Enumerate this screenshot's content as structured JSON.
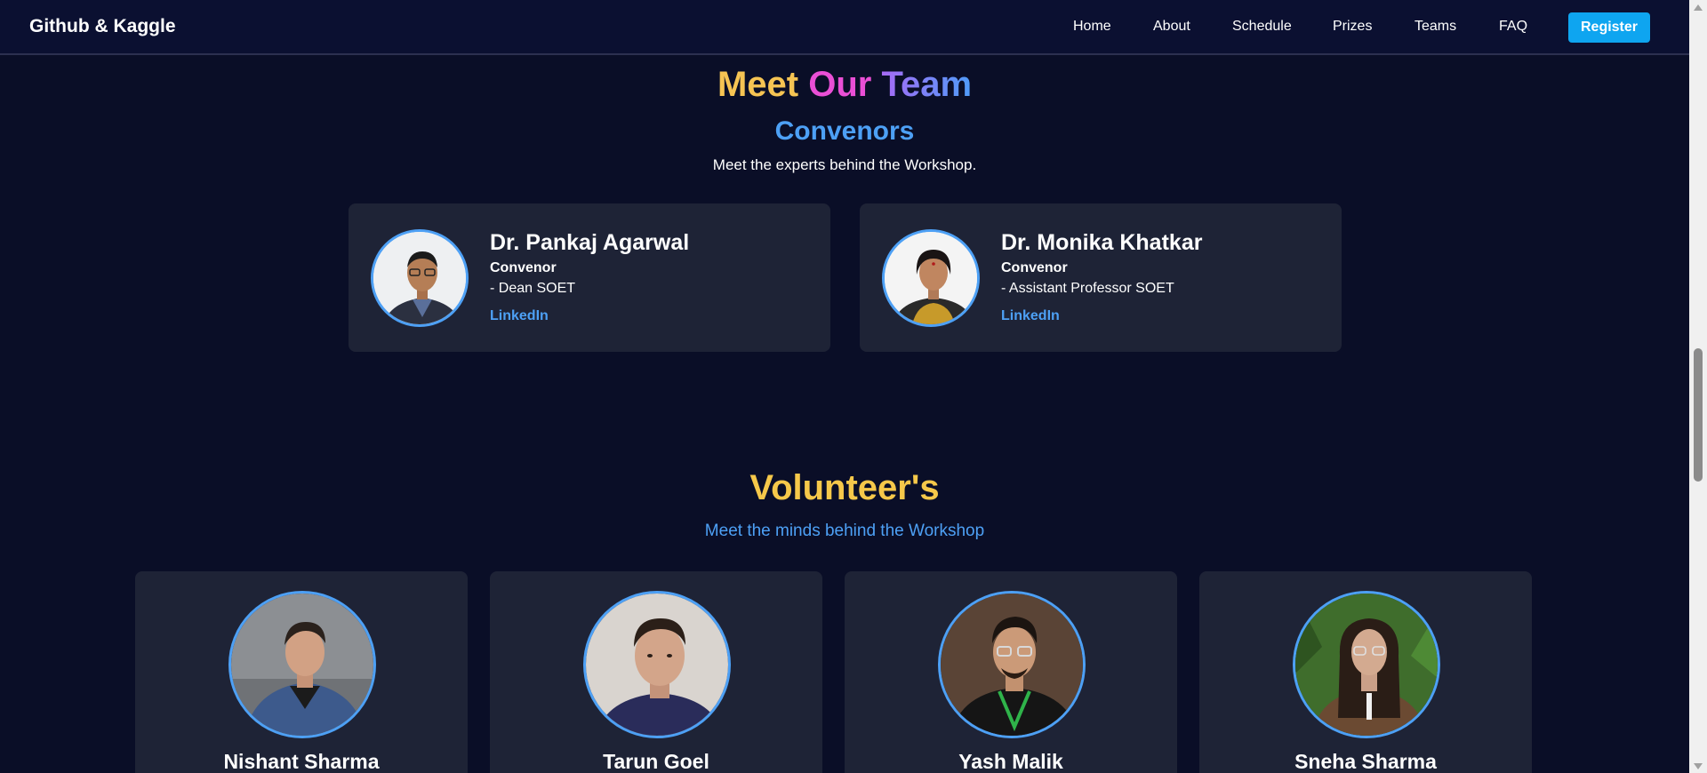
{
  "navbar": {
    "brand": "Github & Kaggle",
    "links": [
      "Home",
      "About",
      "Schedule",
      "Prizes",
      "Teams",
      "FAQ"
    ],
    "register_label": "Register"
  },
  "team_section": {
    "title_words": [
      "Meet",
      "Our",
      "Team"
    ],
    "convenors_title": "Convenors",
    "convenors_subtitle": "Meet the experts behind the Workshop."
  },
  "convenors": [
    {
      "name": "Dr. Pankaj Agarwal",
      "role": "Convenor",
      "dept": "- Dean SOET",
      "link": "LinkedIn"
    },
    {
      "name": "Dr. Monika Khatkar",
      "role": "Convenor",
      "dept": "- Assistant Professor SOET",
      "link": "LinkedIn"
    }
  ],
  "volunteers_section": {
    "title": "Volunteer's",
    "subtitle": "Meet the minds behind the Workshop"
  },
  "volunteers": [
    {
      "name": "Nishant Sharma"
    },
    {
      "name": "Tarun Goel"
    },
    {
      "name": "Yash Malik"
    },
    {
      "name": "Sneha Sharma"
    }
  ],
  "colors": {
    "background": "#0a0e27",
    "card": "#1e2336",
    "accent_blue": "#4da0f5",
    "register_button": "#0ea5f0",
    "volunteer_title": "#f6c84a"
  },
  "icons": [
    "scroll-up-arrow-icon",
    "scroll-down-arrow-icon"
  ]
}
